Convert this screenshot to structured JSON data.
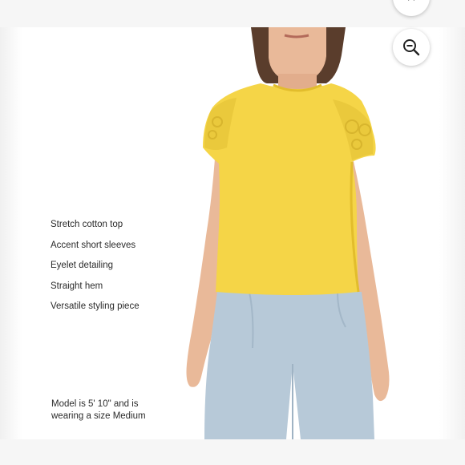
{
  "features": [
    "Stretch cotton top",
    "Accent short sleeves",
    "Eyelet detailing",
    "Straight hem",
    "Versatile styling piece"
  ],
  "model_note": {
    "line1": "Model is 5' 10\" and is",
    "line2": "wearing a size Medium"
  },
  "colors": {
    "top": "#f5d547",
    "top_shadow": "#e2bd2c",
    "jeans": "#b7c9d8",
    "skin": "#e9b999",
    "hair": "#5a3d2c"
  },
  "icons": {
    "zoom": "zoom-out-icon",
    "top_button": "chevron-icon"
  }
}
